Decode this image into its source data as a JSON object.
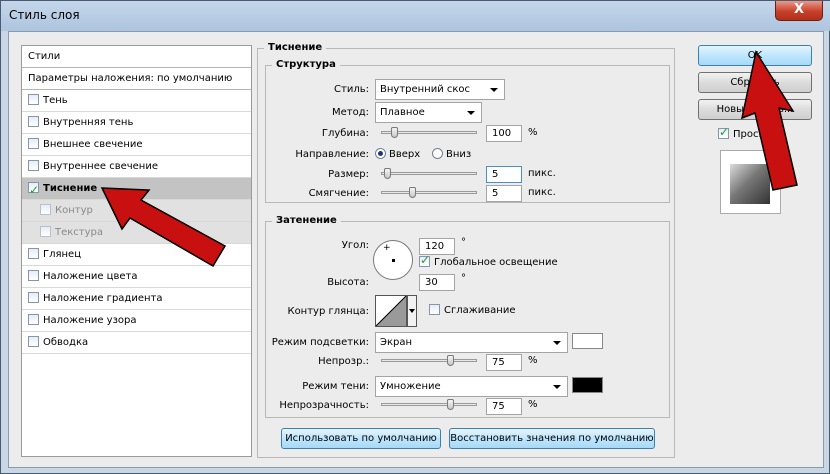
{
  "window": {
    "title": "Стиль слоя",
    "close_label": "X"
  },
  "styles_panel": {
    "header": "Стили",
    "blend_defaults": "Параметры наложения: по умолчанию",
    "items": [
      {
        "label": "Тень",
        "checked": false
      },
      {
        "label": "Внутренняя тень",
        "checked": false
      },
      {
        "label": "Внешнее свечение",
        "checked": false
      },
      {
        "label": "Внутреннее свечение",
        "checked": false
      },
      {
        "label": "Тиснение",
        "checked": true
      },
      {
        "label": "Контур",
        "checked": false
      },
      {
        "label": "Текстура",
        "checked": false
      },
      {
        "label": "Глянец",
        "checked": false
      },
      {
        "label": "Наложение цвета",
        "checked": false
      },
      {
        "label": "Наложение градиента",
        "checked": false
      },
      {
        "label": "Наложение узора",
        "checked": false
      },
      {
        "label": "Обводка",
        "checked": false
      }
    ]
  },
  "emboss": {
    "title": "Тиснение",
    "structure": {
      "title": "Структура",
      "style_label": "Стиль:",
      "style_value": "Внутренний скос",
      "method_label": "Метод:",
      "method_value": "Плавное",
      "depth_label": "Глубина:",
      "depth_value": "100",
      "depth_unit": "%",
      "depth_level": 100,
      "direction_label": "Направление:",
      "dir_up": "Вверх",
      "dir_down": "Вниз",
      "size_label": "Размер:",
      "size_value": "5",
      "size_unit": "пикс.",
      "size_level": 5,
      "soften_label": "Смягчение:",
      "soften_value": "5",
      "soften_unit": "пикс.",
      "soften_level": 5
    },
    "shading": {
      "title": "Затенение",
      "angle_label": "Угол:",
      "angle_value": "120",
      "angle_unit": "°",
      "global_light_label": "Глобальное освещение",
      "global_light_checked": true,
      "altitude_label": "Высота:",
      "altitude_value": "30",
      "altitude_unit": "°",
      "gloss_contour_label": "Контур глянца:",
      "antialias_label": "Сглаживание",
      "antialias_checked": false,
      "highlight_mode_label": "Режим подсветки:",
      "highlight_mode_value": "Экран",
      "highlight_color": "#ffffff",
      "highlight_opacity_label": "Непрозр.:",
      "highlight_opacity_value": "75",
      "highlight_opacity_unit": "%",
      "highlight_opacity_level": 75,
      "shadow_mode_label": "Режим тени:",
      "shadow_mode_value": "Умножение",
      "shadow_color": "#000000",
      "shadow_opacity_label": "Непрозрачность:",
      "shadow_opacity_value": "75",
      "shadow_opacity_unit": "%",
      "shadow_opacity_level": 75
    },
    "make_default_label": "Использовать по умолчанию",
    "reset_default_label": "Восстановить значения по умолчанию"
  },
  "right": {
    "ok_label": "OK",
    "reset_label": "Сбросить",
    "new_style_label": "Новый стиль...",
    "preview_label": "Просмотр",
    "preview_checked": true
  },
  "annotation_color": "#c81010"
}
